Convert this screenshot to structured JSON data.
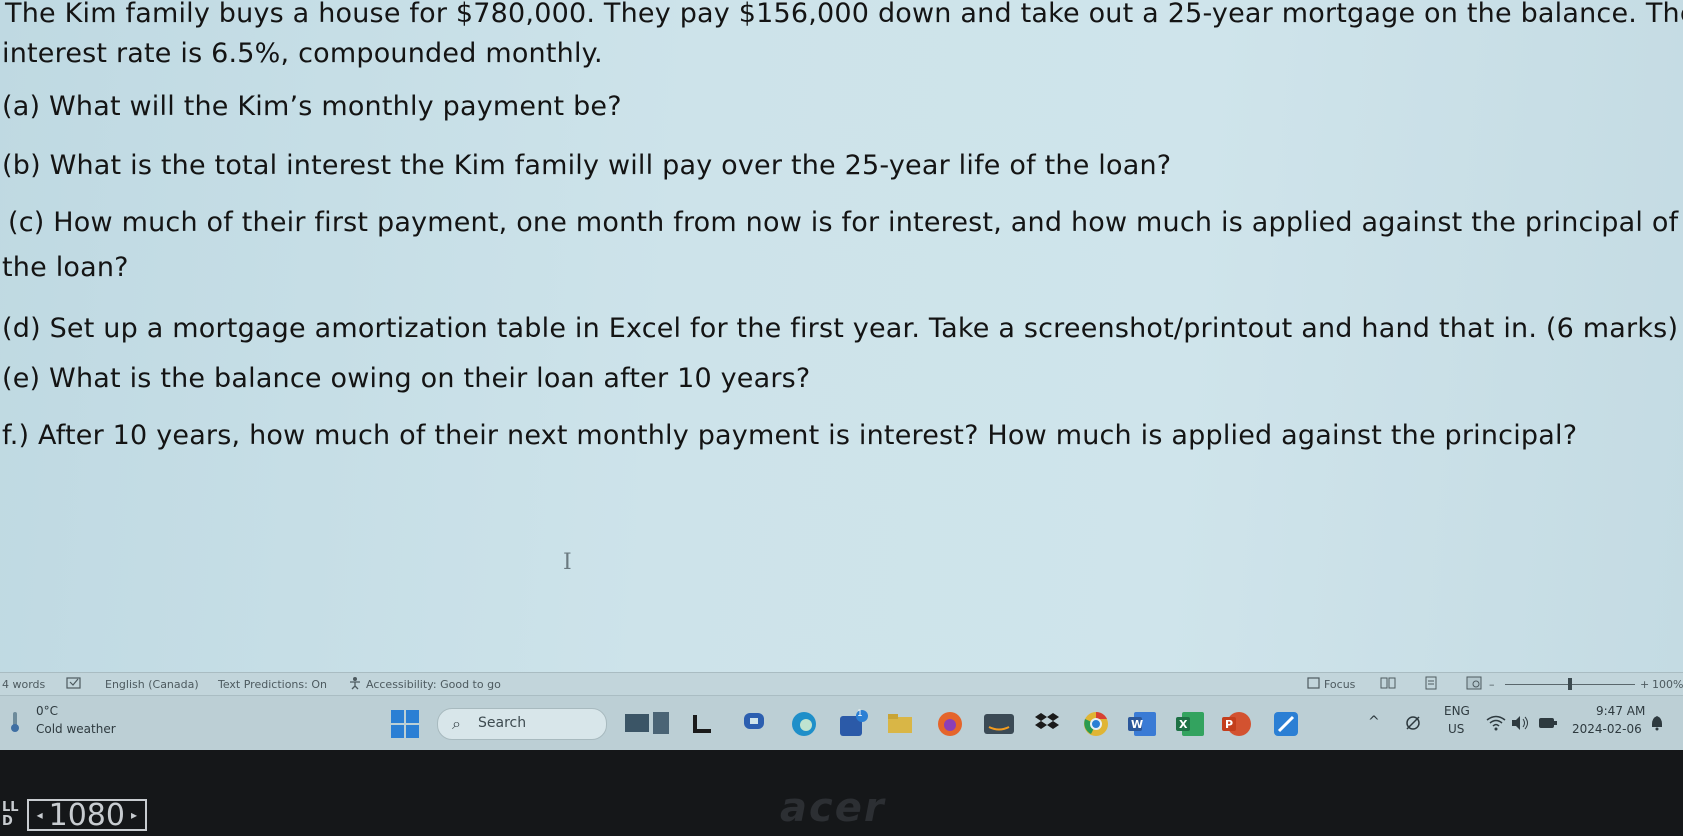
{
  "document": {
    "lines": [
      "The Kim family buys a house for $780,000. They pay $156,000 down and take out a 25-year mortgage on the balance. The",
      "interest rate is 6.5%, compounded monthly.",
      "(a) What will the Kim’s monthly payment be?",
      "(b) What is the total interest the Kim family will pay over the 25-year life of the loan?",
      "(c) How much of their first payment, one month from now is for interest, and how much is applied against the principal of",
      "the loan?",
      "(d) Set up a mortgage amortization table in Excel for the first year. Take a screenshot/printout and hand that in. (6 marks)",
      "(e) What is the balance owing on their loan after 10 years?",
      "f.) After 10 years, how much of their next monthly payment is interest? How much is applied against the principal?"
    ]
  },
  "statusbar": {
    "word_count": "4 words",
    "language": "English (Canada)",
    "text_predictions": "Text Predictions: On",
    "accessibility": "Accessibility: Good to go",
    "focus": "Focus",
    "zoom": "100%",
    "zoom_level": 0.5
  },
  "taskbar": {
    "weather_temp": "0°C",
    "weather_desc": "Cold weather",
    "search_label": "Search",
    "notification_badge": "1",
    "lang_top": "ENG",
    "lang_bottom": "US",
    "time": "9:47 AM",
    "date": "2024-02-06"
  },
  "monitor": {
    "osd_value": "1080",
    "osd_tag_top": "LL",
    "osd_tag_bottom": "D",
    "brand": "acer"
  },
  "colors": {
    "word_blue": "#2b579a",
    "excel_green": "#1e7145",
    "ppt_orange": "#c43e1c",
    "windows_blue": "#0078d4"
  }
}
